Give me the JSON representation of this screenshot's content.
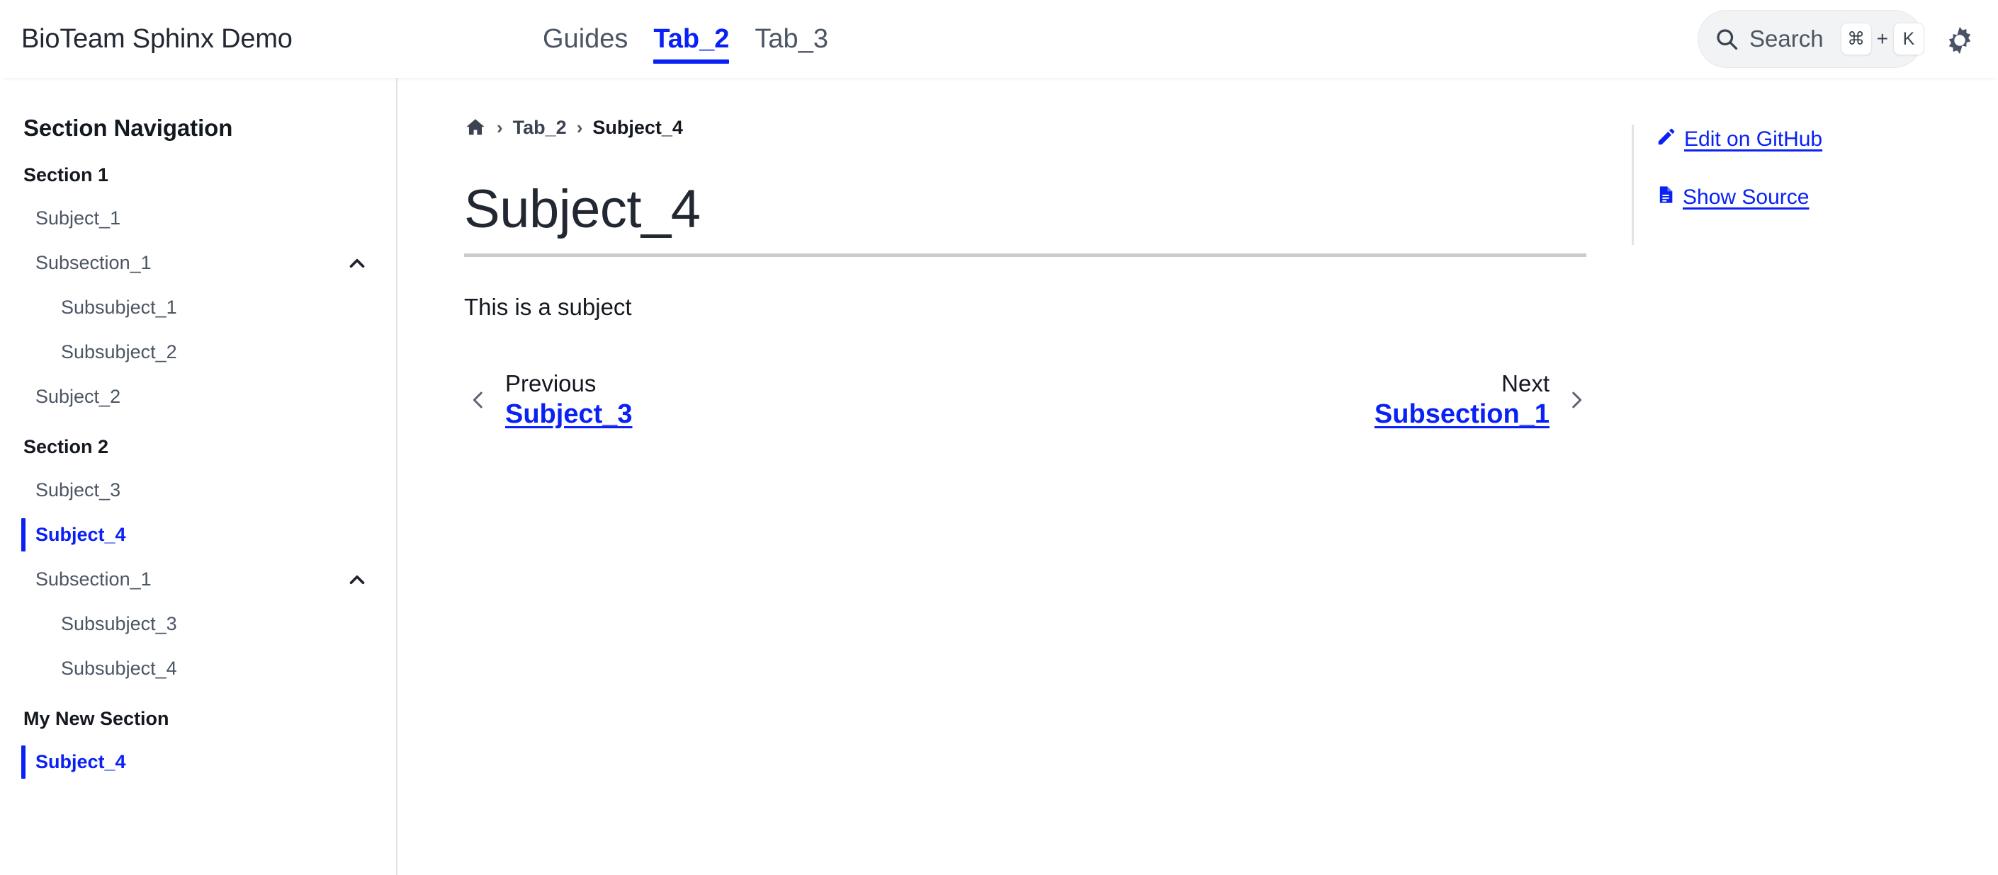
{
  "header": {
    "brand": "BioTeam Sphinx Demo",
    "tabs": [
      {
        "label": "Guides",
        "active": false
      },
      {
        "label": "Tab_2",
        "active": true
      },
      {
        "label": "Tab_3",
        "active": false
      }
    ],
    "search": {
      "label": "Search",
      "icon": "search-icon",
      "shortcut_key1": "⌘",
      "shortcut_plus": "+",
      "shortcut_key2": "K"
    },
    "theme_toggle_icon": "sun-gear-icon"
  },
  "sidebar": {
    "title": "Section Navigation",
    "groups": [
      {
        "caption": "Section 1",
        "items": [
          {
            "label": "Subject_1",
            "level": 1,
            "current": false,
            "chevron": false
          },
          {
            "label": "Subsection_1",
            "level": 1,
            "current": false,
            "chevron": true
          },
          {
            "label": "Subsubject_1",
            "level": 2,
            "current": false,
            "chevron": false
          },
          {
            "label": "Subsubject_2",
            "level": 2,
            "current": false,
            "chevron": false
          },
          {
            "label": "Subject_2",
            "level": 1,
            "current": false,
            "chevron": false
          }
        ]
      },
      {
        "caption": "Section 2",
        "items": [
          {
            "label": "Subject_3",
            "level": 1,
            "current": false,
            "chevron": false
          },
          {
            "label": "Subject_4",
            "level": 1,
            "current": true,
            "chevron": false
          },
          {
            "label": "Subsection_1",
            "level": 1,
            "current": false,
            "chevron": true
          },
          {
            "label": "Subsubject_3",
            "level": 2,
            "current": false,
            "chevron": false
          },
          {
            "label": "Subsubject_4",
            "level": 2,
            "current": false,
            "chevron": false
          }
        ]
      },
      {
        "caption": "My New Section",
        "items": [
          {
            "label": "Subject_4",
            "level": 1,
            "current": true,
            "chevron": false
          }
        ]
      }
    ]
  },
  "breadcrumb": {
    "home_icon": "home-icon",
    "separator": "›",
    "items": [
      {
        "label": "Tab_2",
        "current": false
      },
      {
        "label": "Subject_4",
        "current": true
      }
    ]
  },
  "content": {
    "title": "Subject_4",
    "paragraph": "This is a subject"
  },
  "prevnext": {
    "previous": {
      "label": "Previous",
      "target": "Subject_3",
      "icon": "chevron-left-icon"
    },
    "next": {
      "label": "Next",
      "target": "Subsection_1",
      "icon": "chevron-right-icon"
    }
  },
  "rightbar": {
    "links": [
      {
        "label": "Edit on GitHub",
        "icon": "pencil-icon"
      },
      {
        "label": "Show Source",
        "icon": "document-icon"
      }
    ]
  },
  "colors": {
    "accent": "#0a21f5",
    "text": "#14181f",
    "muted": "#4b5563",
    "border": "#dfe3e8",
    "pill_bg": "#f1f3f5"
  }
}
